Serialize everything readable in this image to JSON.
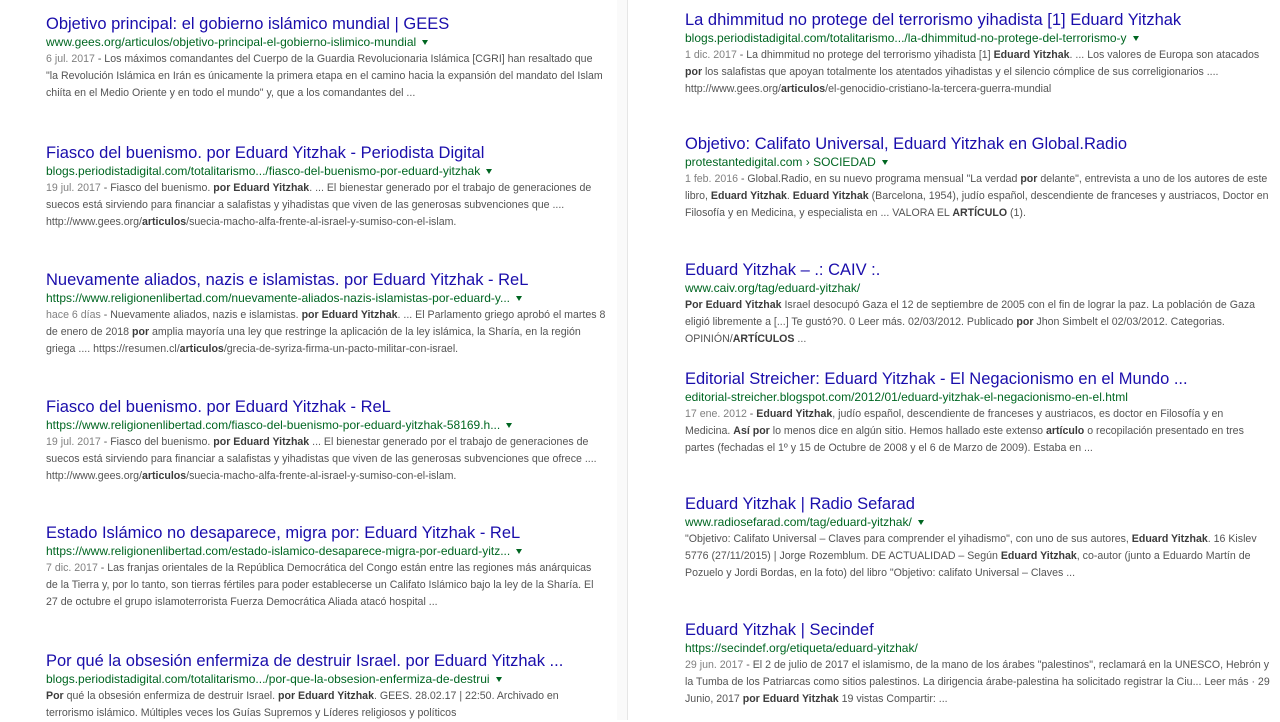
{
  "left": [
    {
      "title": "Objetivo principal: el gobierno islámico mundial | GEES",
      "url": "www.gees.org/articulos/objetivo-principal-el-gobierno-islimico-mundial",
      "snippet": [
        {
          "date": "6 jul. 2017"
        },
        {
          "t": " - Los máximos comandantes del Cuerpo de la Guardia Revolucionaria Islámica [CGRI] han resaltado que \"la Revolución Islámica en Irán es únicamente la primera etapa en el camino hacia la expansión del mandato del Islam chiíta en el Medio Oriente y en todo el mundo\" y, que a los comandantes del ..."
        }
      ]
    },
    {
      "title": "Fiasco del buenismo. por Eduard Yitzhak - Periodista Digital",
      "url": "blogs.periodistadigital.com/totalitarismo.../fiasco-del-buenismo-por-eduard-yitzhak",
      "snippet": [
        {
          "date": "19 jul. 2017"
        },
        {
          "t": " - Fiasco del buenismo. "
        },
        {
          "b": "por Eduard Yitzhak"
        },
        {
          "t": ". ... El bienestar generado por el trabajo de generaciones de suecos está sirviendo para financiar a salafistas y yihadistas que viven de las generosas subvenciones que .... http://www.gees.org/"
        },
        {
          "b": "articulos"
        },
        {
          "t": "/suecia-macho-alfa-frente-al-israel-y-sumiso-con-el-islam."
        }
      ]
    },
    {
      "title": "Nuevamente aliados, nazis e islamistas. por Eduard Yitzhak - ReL",
      "url": "https://www.religionenlibertad.com/nuevamente-aliados-nazis-islamistas-por-eduard-y...",
      "snippet": [
        {
          "date": "hace 6 días"
        },
        {
          "t": " - Nuevamente aliados, nazis e islamistas. "
        },
        {
          "b": "por Eduard Yitzhak"
        },
        {
          "t": ". ... El Parlamento griego aprobó el martes 8 de enero de 2018 "
        },
        {
          "b": "por"
        },
        {
          "t": " amplia mayoría una ley que restringe la aplicación de la ley islámica, la Sharía, en la región griega .... https://resumen.cl/"
        },
        {
          "b": "articulos"
        },
        {
          "t": "/grecia-de-syriza-firma-un-pacto-militar-con-israel."
        }
      ]
    },
    {
      "title": "Fiasco del buenismo. por Eduard Yitzhak - ReL",
      "url": "https://www.religionenlibertad.com/fiasco-del-buenismo-por-eduard-yitzhak-58169.h...",
      "snippet": [
        {
          "date": "19 jul. 2017"
        },
        {
          "t": " - Fiasco del buenismo. "
        },
        {
          "b": "por Eduard Yitzhak"
        },
        {
          "t": " ... El bienestar generado por el trabajo de generaciones de suecos está sirviendo para financiar a salafistas y yihadistas que viven de las generosas subvenciones que ofrece .... http://www.gees.org/"
        },
        {
          "b": "articulos"
        },
        {
          "t": "/suecia-macho-alfa-frente-al-israel-y-sumiso-con-el-islam."
        }
      ]
    },
    {
      "title": "Estado Islámico no desaparece, migra por: Eduard Yitzhak - ReL",
      "url": "https://www.religionenlibertad.com/estado-islamico-desaparece-migra-por-eduard-yitz...",
      "snippet": [
        {
          "date": "7 dic. 2017"
        },
        {
          "t": " - Las franjas orientales de la República Democrática del Congo están entre las regiones más anárquicas de la Tierra y, por lo tanto, son tierras fértiles para poder establecerse un Califato Islámico bajo la ley de la Sharía. El 27 de octubre el grupo islamoterrorista Fuerza Democrática Aliada atacó hospital ..."
        }
      ]
    },
    {
      "title": "Por qué la obsesión enfermiza de destruir Israel. por Eduard Yitzhak ...",
      "url": "blogs.periodistadigital.com/totalitarismo.../por-que-la-obsesion-enfermiza-de-destrui",
      "snippet": [
        {
          "b": "Por"
        },
        {
          "t": " qué la obsesión enfermiza de destruir Israel. "
        },
        {
          "b": "por Eduard Yitzhak"
        },
        {
          "t": ". GEES. 28.02.17 | 22:50. Archivado en terrorismo islámico. Múltiples veces los Guías Supremos y Líderes religiosos y políticos"
        }
      ]
    }
  ],
  "right": [
    {
      "title": "La dhimmitud no protege del terrorismo yihadista [1] Eduard Yitzhak",
      "url": "blogs.periodistadigital.com/totalitarismo.../la-dhimmitud-no-protege-del-terrorismo-y",
      "snippet": [
        {
          "date": "1 dic. 2017"
        },
        {
          "t": " - La dhimmitud no protege del terrorismo yihadista [1] "
        },
        {
          "b": "Eduard Yitzhak"
        },
        {
          "t": ". ... Los valores de Europa son atacados "
        },
        {
          "b": "por"
        },
        {
          "t": " los salafistas que apoyan totalmente los atentados yihadistas y el silencio cómplice de sus correligionarios .... http://www.gees.org/"
        },
        {
          "b": "articulos"
        },
        {
          "t": "/el-genocidio-cristiano-la-tercera-guerra-mundial"
        }
      ]
    },
    {
      "title": "Objetivo: Califato Universal, Eduard Yitzhak en Global.Radio",
      "url": "protestantedigital.com › SOCIEDAD",
      "snippet": [
        {
          "date": "1 feb. 2016"
        },
        {
          "t": " - Global.Radio, en su nuevo programa mensual \"La verdad "
        },
        {
          "b": "por"
        },
        {
          "t": " delante\", entrevista a uno de los autores de este libro, "
        },
        {
          "b": "Eduard Yitzhak"
        },
        {
          "t": ". "
        },
        {
          "b": "Eduard Yitzhak"
        },
        {
          "t": " (Barcelona, 1954), judío español, descendiente de franceses y austriacos, Doctor en Filosofía y en Medicina, y especialista en ... VALORA EL "
        },
        {
          "b": "ARTÍCULO"
        },
        {
          "t": " (1)."
        }
      ]
    },
    {
      "title": "Eduard Yitzhak – .: CAIV :.",
      "url": "www.caiv.org/tag/eduard-yitzhak/",
      "snippet": [
        {
          "b": "Por Eduard Yitzhak"
        },
        {
          "t": " Israel desocupó Gaza el 12 de septiembre de 2005 con el fin de lograr la paz. La población de Gaza eligió libremente a [...] Te gustó?0. 0 Leer más. 02/03/2012. Publicado "
        },
        {
          "b": "por"
        },
        {
          "t": " Jhon Simbelt el 02/03/2012. Categorias. OPINIÓN/"
        },
        {
          "b": "ARTÍCULOS"
        },
        {
          "t": " ..."
        }
      ]
    },
    {
      "title": "Editorial Streicher: Eduard Yitzhak - El Negacionismo en el Mundo ...",
      "url": "editorial-streicher.blogspot.com/2012/01/eduard-yitzhak-el-negacionismo-en-el.html",
      "snippet": [
        {
          "date": "17 ene. 2012"
        },
        {
          "t": " - "
        },
        {
          "b": "Eduard Yitzhak"
        },
        {
          "t": ", judío español, descendiente de franceses y austriacos, es doctor en Filosofía y en Medicina. "
        },
        {
          "b": "Así por"
        },
        {
          "t": " lo menos dice en algún sitio. Hemos hallado este extenso "
        },
        {
          "b": "artículo"
        },
        {
          "t": " o recopilación presentado en tres partes (fechadas el 1º y 15 de Octubre de 2008 y el 6 de Marzo de 2009). Estaba en ..."
        }
      ]
    },
    {
      "title": "Eduard Yitzhak | Radio Sefarad",
      "url": "www.radiosefarad.com/tag/eduard-yitzhak/",
      "snippet": [
        {
          "t": "\"Objetivo: Califato Universal – Claves para comprender el yihadismo\", con uno de sus autores, "
        },
        {
          "b": "Eduard Yitzhak"
        },
        {
          "t": ". 16 Kislev 5776 (27/11/2015) | Jorge Rozemblum. DE ACTUALIDAD – Según "
        },
        {
          "b": "Eduard Yitzhak"
        },
        {
          "t": ", co-autor (junto a Eduardo Martín de Pozuelo y Jordi Bordas, en la foto) del libro \"Objetivo: califato Universal – Claves ..."
        }
      ]
    },
    {
      "title": "Eduard Yitzhak | Secindef",
      "url": "https://secindef.org/etiqueta/eduard-yitzhak/",
      "snippet": [
        {
          "date": "29 jun. 2017"
        },
        {
          "t": " - El 2 de julio de 2017 el islamismo, de la mano de los árabes \"palestinos\", reclamará en la UNESCO, Hebrón y la Tumba de los Patriarcas como sitios palestinos. La dirigencia árabe-palestina ha solicitado registrar la Ciu... Leer más · 29 Junio, 2017 "
        },
        {
          "b": "por Eduard Yitzhak"
        },
        {
          "t": " 19 vistas Compartir: ..."
        }
      ]
    }
  ]
}
